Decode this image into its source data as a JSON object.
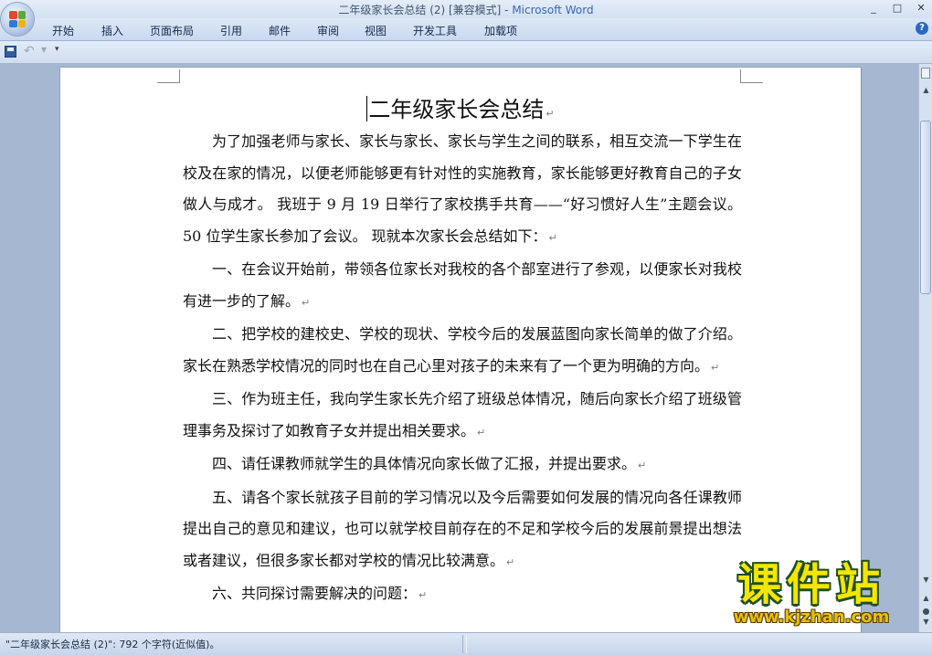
{
  "window": {
    "title_doc": "二年级家长会总结 (2) [兼容模式] - ",
    "title_app": "Microsoft Word",
    "controls": [
      "_",
      "□",
      "✕"
    ]
  },
  "ribbon": {
    "tabs": [
      "开始",
      "插入",
      "页面布局",
      "引用",
      "邮件",
      "审阅",
      "视图",
      "开发工具",
      "加载项"
    ],
    "help_symbol": "?"
  },
  "quick_access": {
    "icons": [
      "save-icon",
      "undo-icon",
      "customize-icon"
    ]
  },
  "document": {
    "title": "二年级家长会总结",
    "paragraphs": [
      "为了加强老师与家长、家长与家长、家长与学生之间的联系，相互交流一下学生在校及在家的情况，以便老师能够更有针对性的实施教育，家长能够更好教育自己的子女做人与成才。 我班于 9 月 19 日举行了家校携手共育——“好习惯好人生”主题会议。50 位学生家长参加了会议。 现就本次家长会总结如下：",
      "一、在会议开始前，带领各位家长对我校的各个部室进行了参观，以便家长对我校有进一步的了解。",
      "二、把学校的建校史、学校的现状、学校今后的发展蓝图向家长简单的做了介绍。家长在熟悉学校情况的同时也在自己心里对孩子的未来有了一个更为明确的方向。",
      "三、作为班主任，我向学生家长先介绍了班级总体情况，随后向家长介绍了班级管理事务及探讨了如教育子女并提出相关要求。",
      "四、请任课教师就学生的具体情况向家长做了汇报，并提出要求。",
      "五、请各个家长就孩子目前的学习情况以及今后需要如何发展的情况向各任课教师提出自己的意见和建议，也可以就学校目前存在的不足和学校今后的发展前景提出想法或者建议，但很多家长都对学校的情况比较满意。",
      "六、共同探讨需要解决的问题："
    ],
    "paragraph_mark": "↵"
  },
  "status_bar": {
    "text": "\"二年级家长会总结 (2)\": 792 个字符(近似值)。"
  },
  "watermark": {
    "logo": "课件站",
    "url": "www.kjzhan.com"
  },
  "colors": {
    "background": "#a6b8d1",
    "ribbon": "#d3e1f3",
    "accent": "#3967b1",
    "watermark_yellow": "#f4e600"
  }
}
